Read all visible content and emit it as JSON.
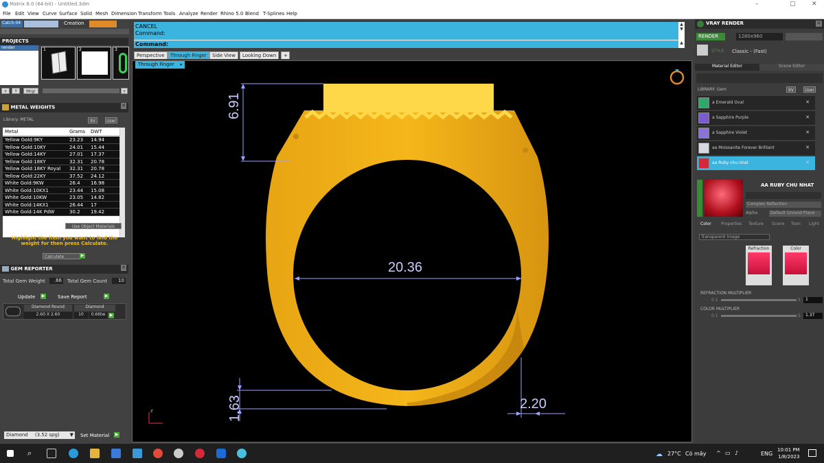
{
  "title": "Matrix 8.0 (64-bit) - Untitled.3dm",
  "window_controls": {
    "min": "–",
    "max": "▢",
    "close": "✕"
  },
  "menu": [
    "File",
    "Edit",
    "View",
    "Curve",
    "Surface",
    "Solid",
    "Mesh",
    "Dimension",
    "Transform",
    "Tools",
    "Analyze",
    "Render",
    "Rhino 5.0",
    "Blend",
    "T-Splines",
    "Help"
  ],
  "top_left": {
    "catch": "Catch-04",
    "creation": "Creation"
  },
  "projects": {
    "title": "PROJECTS",
    "item": "render",
    "thumbs": [
      "1",
      "2",
      "3"
    ],
    "btns": {
      "add": "+",
      "up": "↑",
      "merge": "Mrgr",
      "plus2": "+"
    }
  },
  "metal_weights": {
    "title": "METAL WEIGHTS",
    "library": "Library: METAL",
    "toggle": [
      "9V",
      "User"
    ],
    "headers": [
      "Metal",
      "Grams",
      "DWT"
    ],
    "rows": [
      [
        "Yellow Gold:9KY",
        "23.23",
        "14.94"
      ],
      [
        "Yellow Gold:10KY",
        "24.01",
        "15.44"
      ],
      [
        "Yellow Gold:14KY",
        "27.01",
        "17.37"
      ],
      [
        "Yellow Gold:18KY",
        "32.31",
        "20.78"
      ],
      [
        "Yellow Gold:18KY Royal",
        "32.31",
        "20.78"
      ],
      [
        "Yellow Gold:22KY",
        "37.52",
        "24.12"
      ],
      [
        "White Gold:9KW",
        "26.4",
        "16.98"
      ],
      [
        "White Gold:10KX1",
        "23.44",
        "15.08"
      ],
      [
        "White Gold:10KW",
        "23.05",
        "14.82"
      ],
      [
        "White Gold:14KX1",
        "26.44",
        "17"
      ],
      [
        "White Gold:14K PdW",
        "30.2",
        "19.42"
      ]
    ],
    "use_obj": "Use Object Materials",
    "hint": "Highlight the item you want to find the weight for then press Calculate.",
    "calc": "Calculate"
  },
  "gem_reporter": {
    "title": "GEM REPORTER",
    "total_weight_label": "Total Gem Weight",
    "total_weight": ".66",
    "total_count_label": "Total Gem Count",
    "total_count": "10",
    "update": "Update",
    "save": "Save Report",
    "gem_name": "Diamond Round",
    "gem_size": "2.60 X 2.60",
    "gem_type": "Diamond",
    "gem_count": "10",
    "gem_ctw": "0.66tw"
  },
  "bottom_left": {
    "material": "Diamond",
    "sg": "(3.52 spg)",
    "set": "Set Material"
  },
  "command": {
    "cancel": "CANCEL",
    "cmd1": "Command:",
    "cmd2": "Command:"
  },
  "tabs": [
    "Perspective",
    "Through Finger",
    "Side View",
    "Looking Down",
    "+"
  ],
  "active_view": "Through Finger",
  "dims": {
    "top": "6.91",
    "inner": "20.36",
    "bottom": "1.63",
    "side": "2.20"
  },
  "axis": "z",
  "vray": {
    "title": "VRAY RENDER",
    "render": "RENDER",
    "res": "1280x960",
    "style_label": "STYLE",
    "style": "Classic - (Fast)",
    "tabs": [
      "Material Editor",
      "Scene Editor"
    ],
    "library": "LIBRARY: Gem",
    "toggle": [
      "9V",
      "User"
    ],
    "items": [
      {
        "label": "a Emerald Oval",
        "color": "#2fa86a"
      },
      {
        "label": "a Sapphire Purple",
        "color": "#7a5bd0"
      },
      {
        "label": "a Sapphire Violet",
        "color": "#8a74d8"
      },
      {
        "label": "aa Moissanite Forever Brilliant",
        "color": "#d8d8e0"
      },
      {
        "label": "aa Ruby chu nhat",
        "color": "#d22a3a"
      }
    ],
    "selected_name": "AA RUBY CHU NHAT",
    "reflection": "Complex Reflection",
    "alpha": "Alpha",
    "ground": "Default Ground Plane",
    "sub_tabs": [
      "Color",
      "Properties",
      "Texture",
      "Scene",
      "Toon",
      "Light"
    ],
    "transparent": "Transparent Image",
    "refraction": "Refraction",
    "color": "Color",
    "refr_mult_label": "REFRACTION MULTIPLIER",
    "refr_min": "0.1",
    "refr_max": "5",
    "refr_val": "1",
    "color_mult_label": "COLOR MULTIPLIER",
    "col_min": "0.1",
    "col_max": "5",
    "col_val": "1.37"
  },
  "taskbar": {
    "weather": "27°C",
    "weather_desc": "Có mây",
    "lang": "ENG",
    "time": "10:01 PM",
    "date": "1/8/2023"
  }
}
